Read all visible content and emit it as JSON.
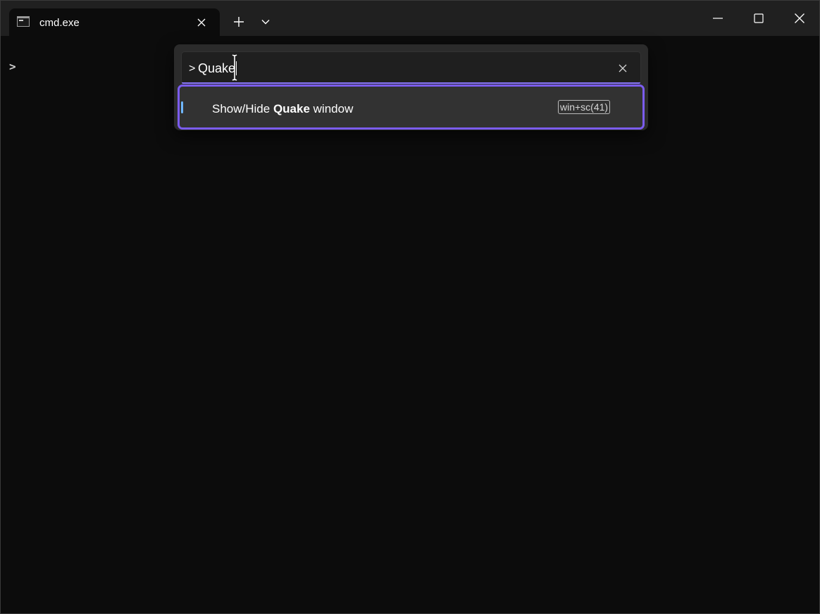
{
  "tab": {
    "title": "cmd.exe",
    "icon": "console-icon"
  },
  "titlebar": {
    "new_tab_icon": "plus-icon",
    "dropdown_icon": "chevron-down-icon",
    "minimize_icon": "minimize-icon",
    "maximize_icon": "maximize-icon",
    "close_icon": "close-icon"
  },
  "terminal": {
    "prompt": ">"
  },
  "palette": {
    "prefix": ">",
    "query": "Quake",
    "clear_icon": "close-icon",
    "accent_color": "#7b5cf0",
    "results": [
      {
        "label_before": "Show/Hide ",
        "label_match": "Quake",
        "label_after": " window",
        "keychord": "win+sc(41)"
      }
    ]
  }
}
